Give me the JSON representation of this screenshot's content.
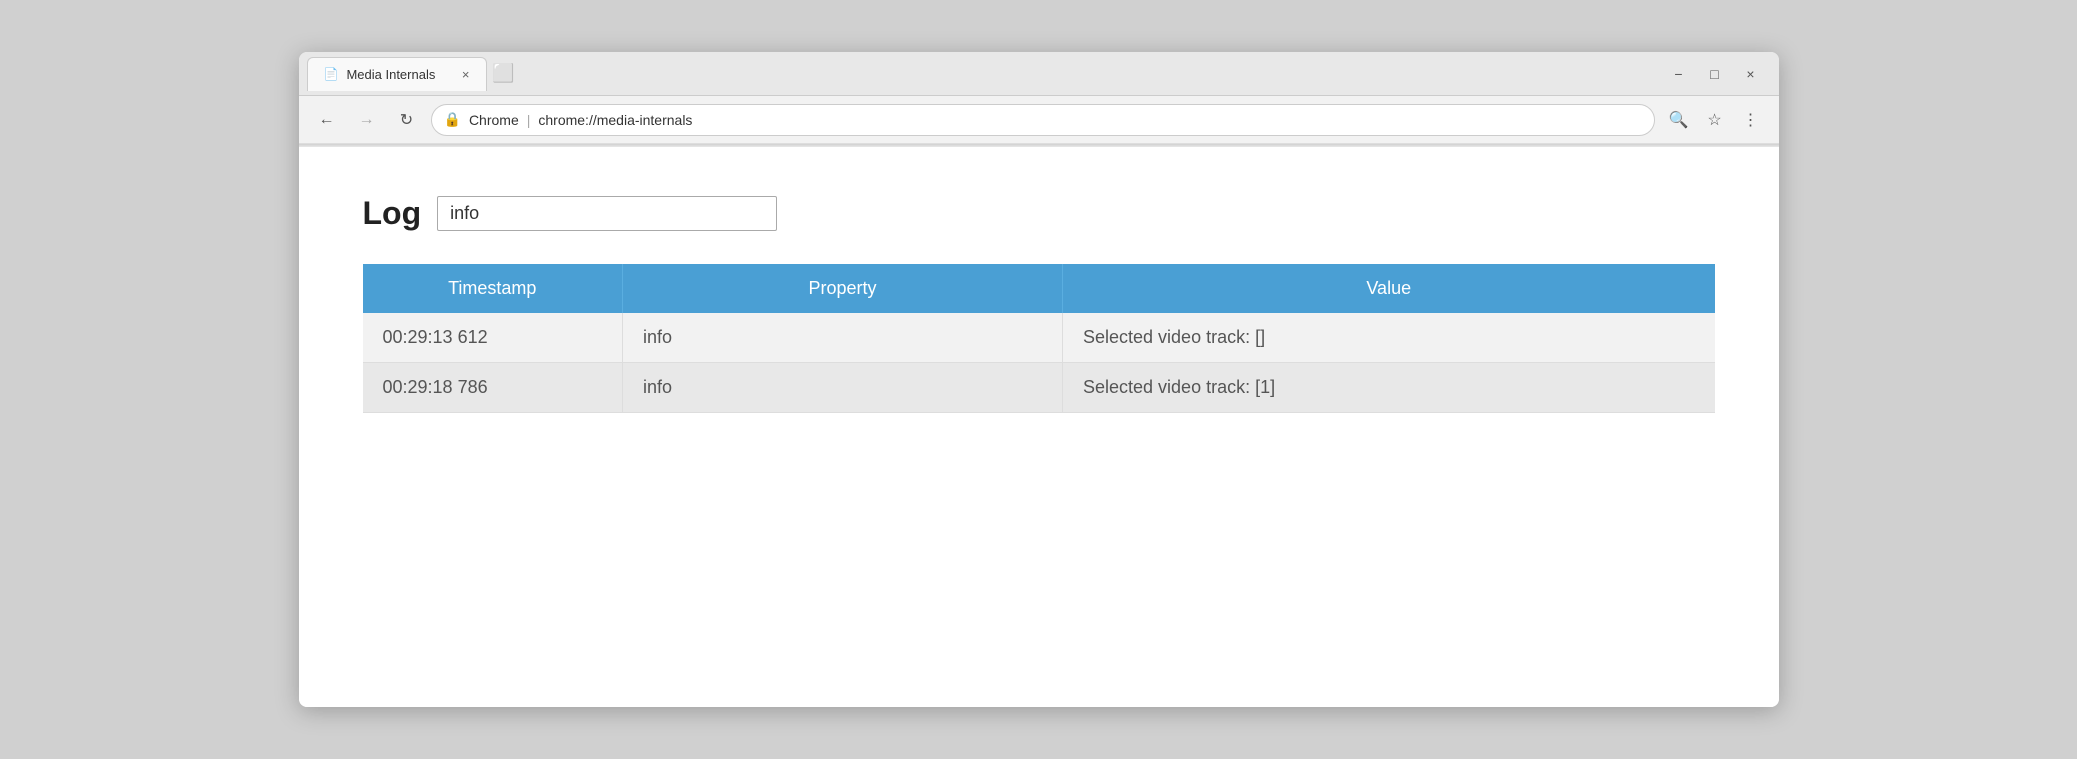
{
  "browser": {
    "tab": {
      "title": "Media Internals",
      "icon": "📄",
      "close_label": "×"
    },
    "window_controls": {
      "minimize": "−",
      "maximize": "□",
      "close": "×"
    },
    "nav": {
      "back": "←",
      "forward": "→",
      "reload": "↻"
    },
    "address_bar": {
      "brand": "Chrome",
      "separator": "|",
      "url": "chrome://media-internals",
      "icon": "🔒"
    },
    "toolbar_icons": {
      "zoom": "🔍",
      "bookmark": "☆",
      "menu": "⋮"
    }
  },
  "page": {
    "log_label": "Log",
    "log_input_value": "info",
    "log_input_placeholder": "",
    "table": {
      "headers": [
        "Timestamp",
        "Property",
        "Value"
      ],
      "rows": [
        {
          "timestamp": "00:29:13 612",
          "property": "info",
          "value": "Selected video track: []"
        },
        {
          "timestamp": "00:29:18 786",
          "property": "info",
          "value": "Selected video track: [1]"
        }
      ]
    }
  }
}
